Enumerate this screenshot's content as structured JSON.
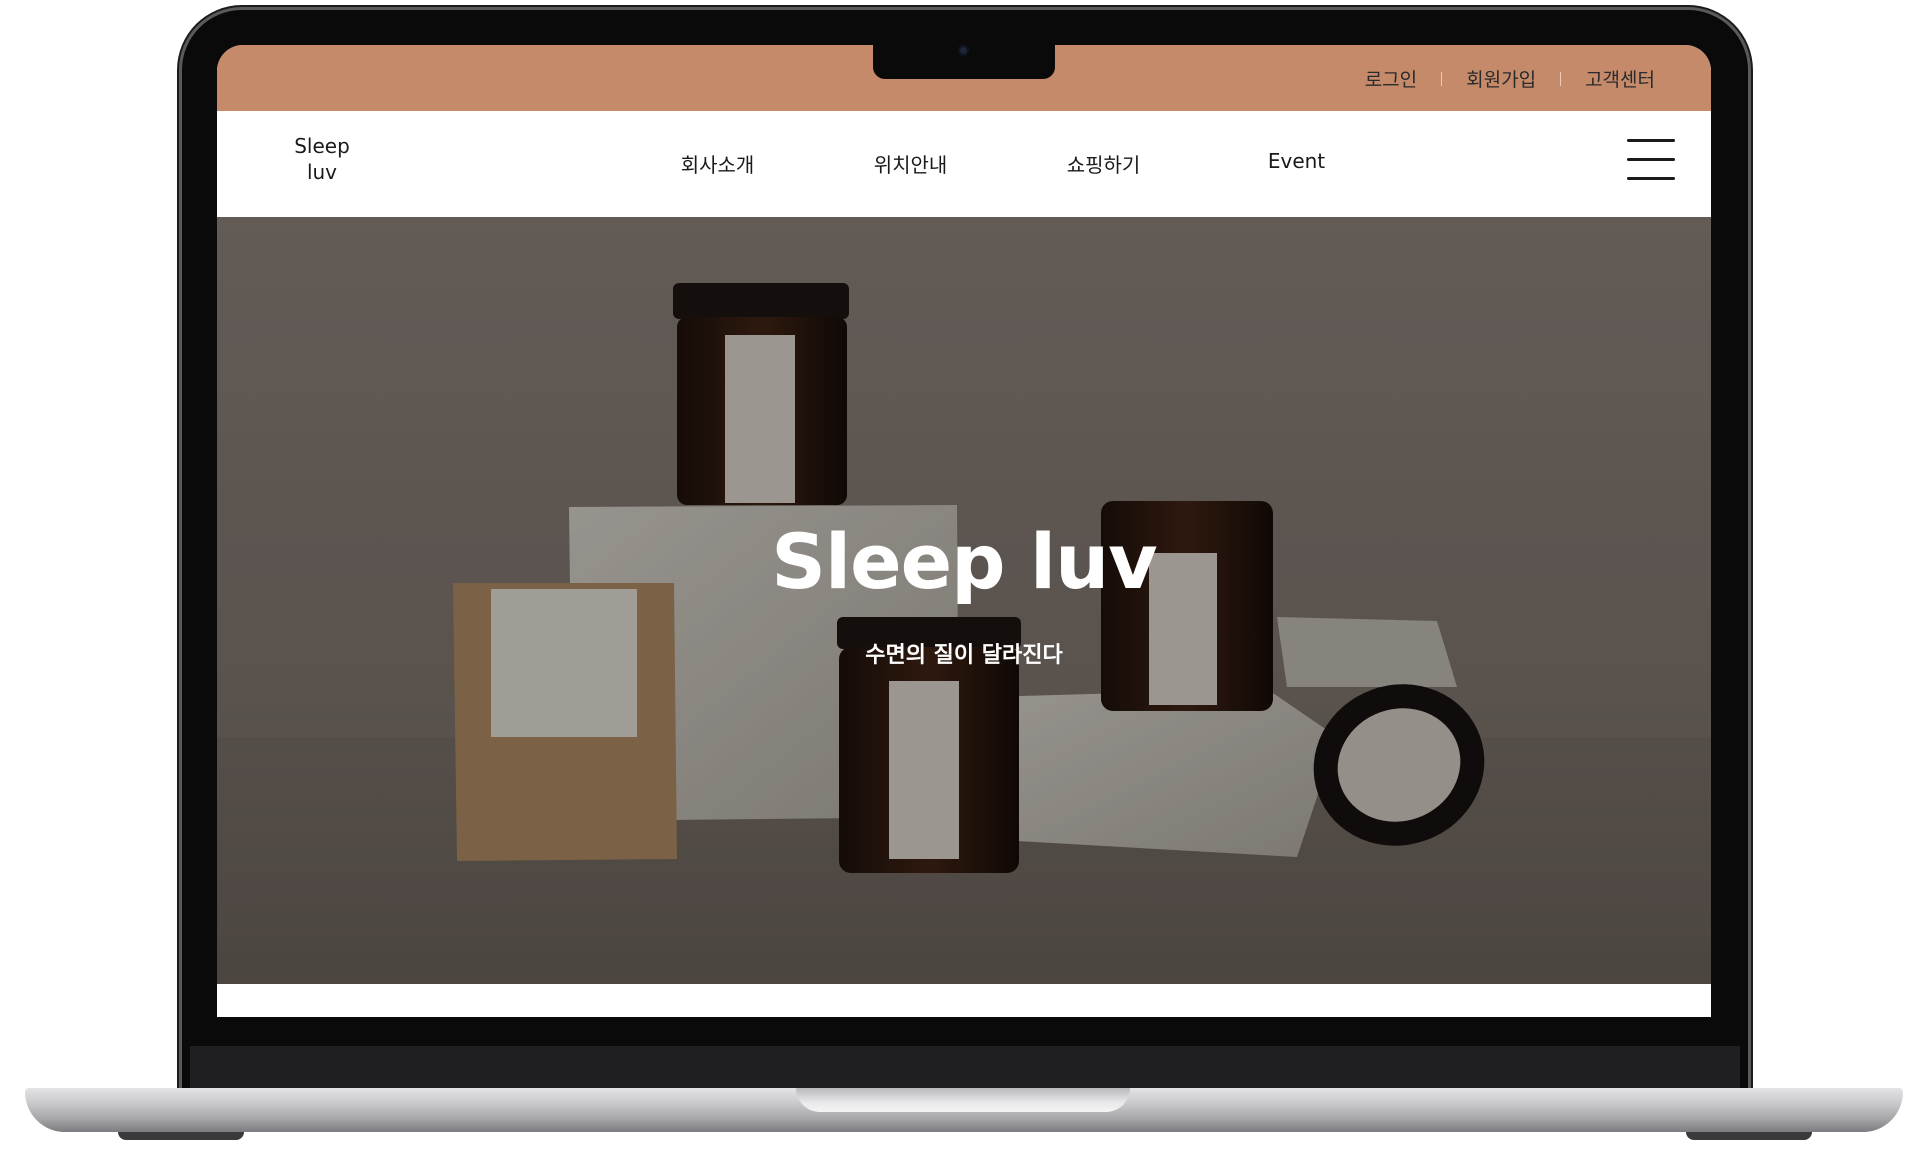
{
  "topbar": {
    "links": [
      "로그인",
      "회원가입",
      "고객센터"
    ],
    "color": "#c58a6a"
  },
  "header": {
    "logo_line1": "Sleep",
    "logo_line2": "luv",
    "nav": [
      "회사소개",
      "위치안내",
      "쇼핑하기",
      "Event"
    ],
    "menu_icon": "hamburger-icon"
  },
  "hero": {
    "title": "Sleep luv",
    "subtitle": "수면의 질이 달라진다",
    "image": "candle-jars-photo"
  }
}
